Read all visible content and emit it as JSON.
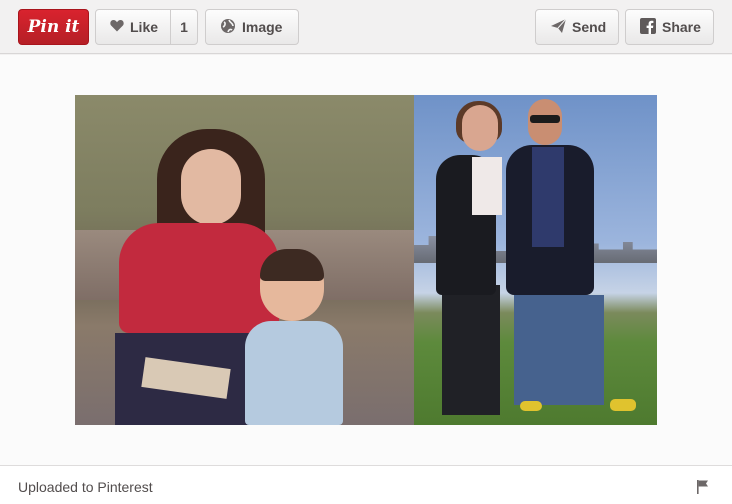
{
  "toolbar": {
    "pin_label": "Pin it",
    "like_label": "Like",
    "like_count": "1",
    "image_label": "Image",
    "send_label": "Send",
    "share_label": "Share"
  },
  "footer": {
    "source_text": "Uploaded to Pinterest"
  },
  "icons": {
    "like": "heart-icon",
    "image": "globe-icon",
    "send": "paper-plane-icon",
    "share": "facebook-icon",
    "report": "flag-icon"
  },
  "colors": {
    "pin_button": "#cb2027",
    "page_background": "#f2f1f1",
    "text": "#524d4d"
  }
}
